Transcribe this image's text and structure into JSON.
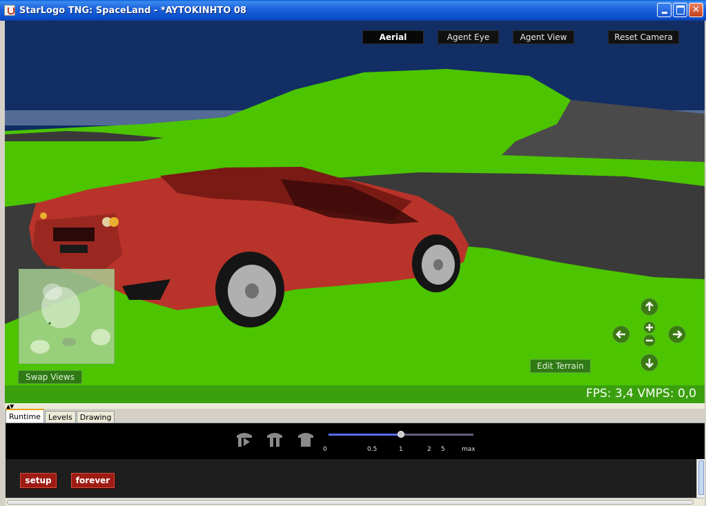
{
  "window": {
    "title": "StarLogo TNG: SpaceLand - *AYTOKINHTO 08"
  },
  "camera": {
    "aerial": "Aerial",
    "agent_eye": "Agent Eye",
    "agent_view": "Agent View",
    "reset": "Reset Camera",
    "active": "Aerial"
  },
  "spaceland": {
    "swap_views": "Swap Views",
    "edit_terrain": "Edit Terrain",
    "fps_status": "FPS: 3,4  VMPS: 0,0"
  },
  "tabs": [
    {
      "label": "Runtime",
      "active": true
    },
    {
      "label": "Levels",
      "active": false
    },
    {
      "label": "Drawing",
      "active": false
    }
  ],
  "runtime": {
    "speed_ticks": [
      "0",
      "0.5",
      "1",
      "2",
      "5",
      "max"
    ],
    "speed_value_fraction": 0.5,
    "buttons": {
      "setup": "setup",
      "forever": "forever"
    }
  },
  "colors": {
    "terrain_green": "#4cc400",
    "road_gray": "#3a3a3a",
    "sky_dark": "#0d2a5c",
    "car_red": "#b8332a",
    "button_red": "#9e1c14"
  }
}
